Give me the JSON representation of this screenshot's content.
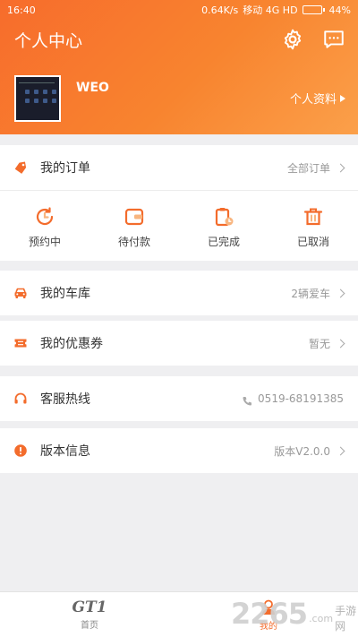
{
  "status_bar": {
    "time": "16:40",
    "net_speed": "0.64K/s",
    "carrier": "移动 4G HD",
    "battery_percent": "44%",
    "battery_level": 0.44
  },
  "header": {
    "title": "个人中心",
    "settings_icon": "gear-icon",
    "message_icon": "message-icon",
    "username": "WEO",
    "profile_link": "个人资料"
  },
  "orders": {
    "label": "我的订单",
    "all_label": "全部订单",
    "statuses": [
      {
        "label": "预约中",
        "icon": "clock-icon"
      },
      {
        "label": "待付款",
        "icon": "wallet-icon"
      },
      {
        "label": "已完成",
        "icon": "clipboard-clock-icon"
      },
      {
        "label": "已取消",
        "icon": "trash-icon"
      }
    ]
  },
  "menu": {
    "garage": {
      "label": "我的车库",
      "value": "2辆爱车"
    },
    "coupons": {
      "label": "我的优惠券",
      "value": "暂无"
    },
    "hotline": {
      "label": "客服热线",
      "value": "0519-68191385"
    },
    "version": {
      "label": "版本信息",
      "value": "版本V2.0.0"
    }
  },
  "tabbar": {
    "home_logo": "GT1",
    "home_label": "首页",
    "mine_label": "我的"
  },
  "watermark": {
    "number": "2265",
    "suffix": ".com",
    "site": "手游网"
  },
  "colors": {
    "accent": "#f36c2c",
    "background": "#efeff1"
  }
}
